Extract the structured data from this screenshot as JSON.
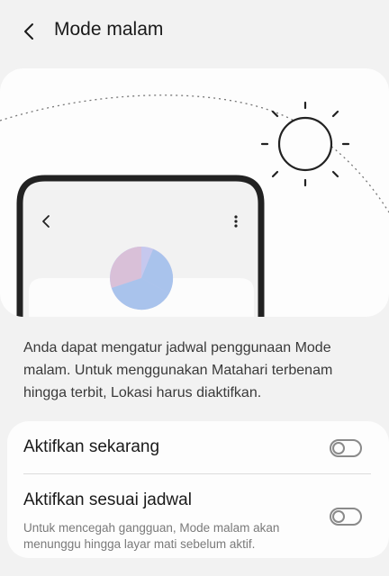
{
  "header": {
    "title": "Mode malam",
    "back_icon": "chevron-left-icon"
  },
  "illustration": {
    "sun_icon": "sun-icon",
    "phone_back_icon": "chevron-left-icon",
    "phone_more_icon": "more-vert-icon",
    "pie_colors": [
      "#a9c3ec",
      "#d9c0d8",
      "#c6c8ee"
    ]
  },
  "description": "Anda dapat mengatur jadwal penggunaan Mode malam. Untuk menggunakan Matahari terbenam hingga terbit, Lokasi harus diaktifkan.",
  "settings": {
    "now": {
      "title": "Aktifkan sekarang",
      "enabled": false
    },
    "schedule": {
      "title": "Aktifkan sesuai jadwal",
      "subtitle": "Untuk mencegah gangguan, Mode malam akan menunggu hingga layar mati sebelum aktif.",
      "enabled": false
    }
  }
}
